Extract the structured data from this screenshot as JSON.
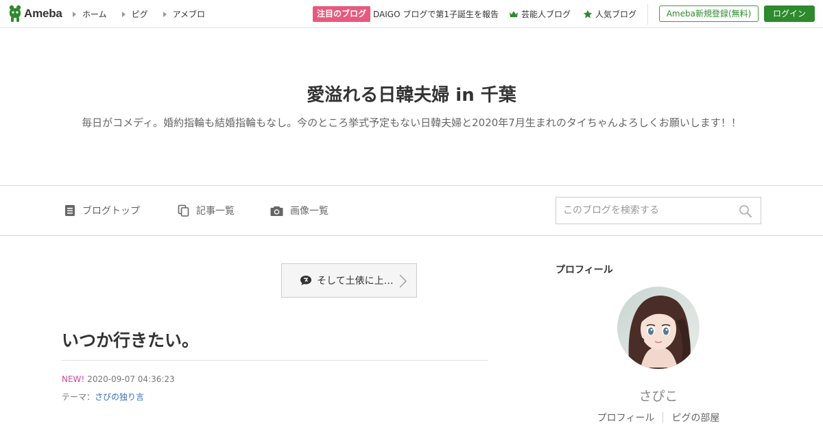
{
  "header": {
    "logo_text": "Ameba",
    "nav": [
      "ホーム",
      "ピグ",
      "アメブロ"
    ],
    "notice_badge": "注目のブログ",
    "notice_text": "DAIGO ブログで第1子誕生を報告",
    "celebrity_blog": "芸能人ブログ",
    "popular_blog": "人気ブログ",
    "register_button": "Ameba新規登録(無料)",
    "login_button": "ログイン"
  },
  "blog": {
    "title": "愛溢れる日韓夫婦 in 千葉",
    "description": "毎日がコメディ。婚約指輪も結婚指輪もなし。今のところ挙式予定もない日韓夫婦と2020年7月生まれのタイちゃんよろしくお願いします！！"
  },
  "blog_nav": {
    "top": "ブログトップ",
    "entries": "記事一覧",
    "images": "画像一覧",
    "search_placeholder": "このブログを検索する"
  },
  "entry": {
    "prev_link": "そして土俵に上…",
    "title": "いつか行きたい。",
    "new_label": "NEW!",
    "datetime": "2020-09-07 04:36:23",
    "theme_label": "テーマ：",
    "theme": "さぴの独り言"
  },
  "sidebar": {
    "heading": "プロフィール",
    "name": "さぴこ",
    "profile_link": "プロフィール",
    "pigg_link": "ピグの部屋"
  },
  "colors": {
    "brand_green": "#2d8a2d",
    "notice_pink": "#e65a7e",
    "new_pink": "#d24a9a",
    "link_blue": "#3570b8"
  },
  "icons": [
    "ameba-logo-icon",
    "triangle-right-icon",
    "crown-icon",
    "star-icon",
    "document-icon",
    "copy-icon",
    "camera-icon",
    "search-icon",
    "speech-bubble-icon",
    "chevron-right-icon"
  ]
}
